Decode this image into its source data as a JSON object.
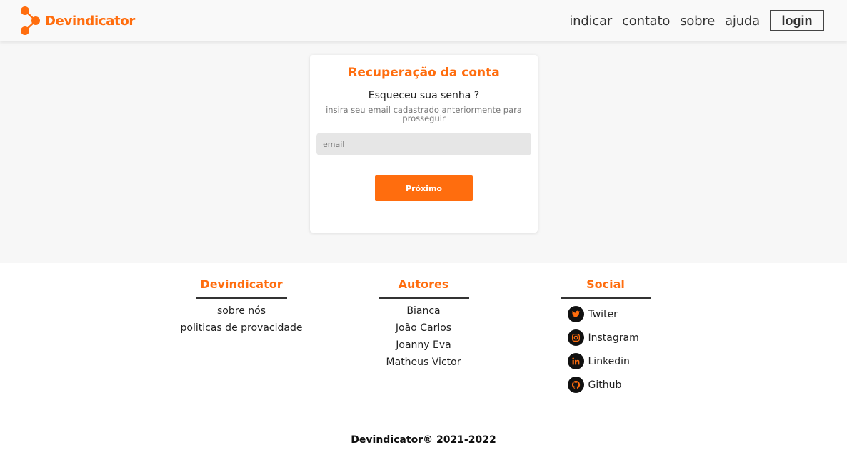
{
  "header": {
    "brand": "Devindicator",
    "nav": [
      "indicar",
      "contato",
      "sobre",
      "ajuda"
    ],
    "login_label": "login"
  },
  "card": {
    "title": "Recuperação da conta",
    "subtitle": "Esqueceu sua senha ?",
    "hint": "insira seu email cadastrado anteriormente para prosseguir",
    "email_placeholder": "email",
    "next_label": "Próximo"
  },
  "footer": {
    "col1": {
      "title": "Devindicator",
      "items": [
        "sobre nós",
        "politicas de provacidade"
      ]
    },
    "col2": {
      "title": "Autores",
      "items": [
        "Bianca",
        "João Carlos",
        "Joanny Eva",
        "Matheus Victor"
      ]
    },
    "col3": {
      "title": "Social",
      "items": [
        {
          "label": "Twiter",
          "icon": "twitter-icon"
        },
        {
          "label": "Instagram",
          "icon": "instagram-icon"
        },
        {
          "label": "Linkedin",
          "icon": "linkedin-icon"
        },
        {
          "label": "Github",
          "icon": "github-icon"
        }
      ]
    },
    "copyright": "Devindicator® 2021-2022"
  },
  "colors": {
    "accent": "#ff6d0e",
    "header_bg": "#f9f9f9",
    "main_bg": "#f7f7f7",
    "input_bg": "#e6e6e6"
  }
}
